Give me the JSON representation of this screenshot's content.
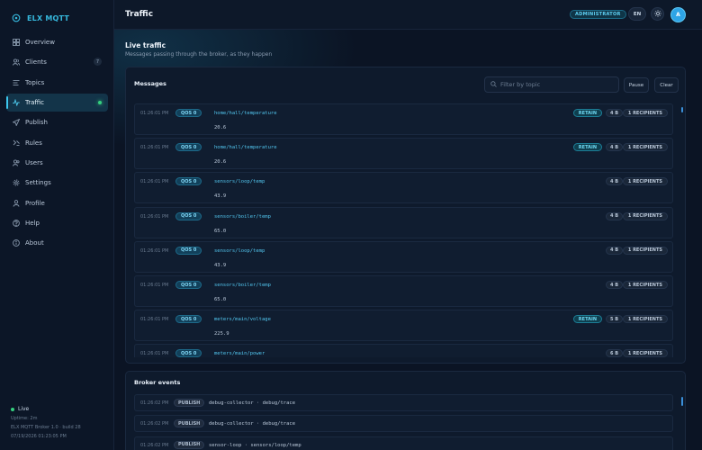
{
  "app": {
    "name": "ELX MQTT"
  },
  "sidebar": {
    "items": [
      {
        "label": "Overview",
        "icon": "grid-icon"
      },
      {
        "label": "Clients",
        "icon": "users-icon",
        "count": "7"
      },
      {
        "label": "Topics",
        "icon": "list-icon"
      },
      {
        "label": "Traffic",
        "icon": "activity-icon",
        "active": true
      },
      {
        "label": "Publish",
        "icon": "send-icon"
      },
      {
        "label": "Rules",
        "icon": "rules-icon"
      },
      {
        "label": "Users",
        "icon": "user-group-icon"
      },
      {
        "label": "Settings",
        "icon": "gear-icon"
      },
      {
        "label": "Profile",
        "icon": "user-icon"
      },
      {
        "label": "Help",
        "icon": "help-icon"
      },
      {
        "label": "About",
        "icon": "info-icon"
      }
    ],
    "footer": {
      "status": "Live",
      "uptime": "Uptime: 2m",
      "version": "ELX MQTT Broker 1.0 · build 28",
      "timestamp": "07/19/2026 01:23:05 PM"
    }
  },
  "header": {
    "title": "Traffic",
    "role": "ADMINISTRATOR",
    "lang": "EN",
    "avatar_initial": "A"
  },
  "live": {
    "title": "Live traffic",
    "subtitle": "Messages passing through the broker, as they happen"
  },
  "messages": {
    "title": "Messages",
    "filter_placeholder": "Filter by topic",
    "pause_label": "Pause",
    "clear_label": "Clear",
    "rows": [
      {
        "time": "01:26:01 PM",
        "qos": "QOS 0",
        "topic": "home/hall/temperature",
        "payload": "20.6",
        "retain": "RETAIN",
        "size": "4 B",
        "recipients": "1 RECIPIENTS"
      },
      {
        "time": "01:26:01 PM",
        "qos": "QOS 0",
        "topic": "home/hall/temperature",
        "payload": "20.6",
        "retain": "RETAIN",
        "size": "4 B",
        "recipients": "1 RECIPIENTS"
      },
      {
        "time": "01:26:01 PM",
        "qos": "QOS 0",
        "topic": "sensors/loop/temp",
        "payload": "43.9",
        "retain": "",
        "size": "4 B",
        "recipients": "1 RECIPIENTS"
      },
      {
        "time": "01:26:01 PM",
        "qos": "QOS 0",
        "topic": "sensors/boiler/temp",
        "payload": "65.0",
        "retain": "",
        "size": "4 B",
        "recipients": "1 RECIPIENTS"
      },
      {
        "time": "01:26:01 PM",
        "qos": "QOS 0",
        "topic": "sensors/loop/temp",
        "payload": "43.9",
        "retain": "",
        "size": "4 B",
        "recipients": "1 RECIPIENTS"
      },
      {
        "time": "01:26:01 PM",
        "qos": "QOS 0",
        "topic": "sensors/boiler/temp",
        "payload": "65.0",
        "retain": "",
        "size": "4 B",
        "recipients": "1 RECIPIENTS"
      },
      {
        "time": "01:26:01 PM",
        "qos": "QOS 0",
        "topic": "meters/main/voltage",
        "payload": "225.9",
        "retain": "RETAIN",
        "size": "5 B",
        "recipients": "1 RECIPIENTS"
      },
      {
        "time": "01:26:01 PM",
        "qos": "QOS 0",
        "topic": "meters/main/power",
        "payload": "",
        "retain": "",
        "size": "6 B",
        "recipients": "1 RECIPIENTS"
      }
    ]
  },
  "events": {
    "title": "Broker events",
    "rows": [
      {
        "time": "01:26:02 PM",
        "type": "PUBLISH",
        "text": "debug-collector · debug/trace"
      },
      {
        "time": "01:26:02 PM",
        "type": "PUBLISH",
        "text": "debug-collector · debug/trace"
      },
      {
        "time": "01:26:02 PM",
        "type": "PUBLISH",
        "text": "sensor-loop · sensors/loop/temp"
      }
    ]
  },
  "colors": {
    "accent": "#36b9de",
    "live": "#35d07f",
    "background": "#0b1424"
  }
}
